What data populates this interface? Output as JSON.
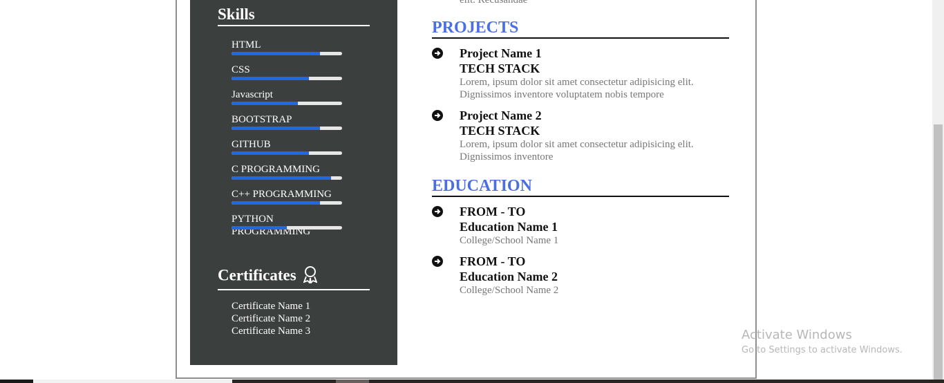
{
  "sidebar": {
    "skills_title": "Skills",
    "skills": [
      {
        "name": "HTML",
        "level": 0.8
      },
      {
        "name": "CSS",
        "level": 0.7
      },
      {
        "name": "Javascript",
        "level": 0.6
      },
      {
        "name": "BOOTSTRAP",
        "level": 0.8
      },
      {
        "name": "GITHUB",
        "level": 0.7
      },
      {
        "name": "C PROGRAMMING",
        "level": 0.9
      },
      {
        "name": "C++ PROGRAMMING",
        "level": 0.8
      },
      {
        "name": "PYTHON PROGRAMMING",
        "level": 0.5
      }
    ],
    "certificates_title": "Certificates",
    "certificates_icon": "award-ribbon-icon",
    "certificates": [
      "Certificate Name 1",
      "Certificate Name 2",
      "Certificate Name 3"
    ]
  },
  "main": {
    "top_cut_text": "elit. Recusandae",
    "projects_title": "PROJECTS",
    "projects": [
      {
        "name": "Project Name 1",
        "stack": "TECH STACK",
        "desc": "Lorem, ipsum dolor sit amet consectetur adipisicing elit. Dignissimos inventore voluptatem nobis tempore"
      },
      {
        "name": "Project Name 2",
        "stack": "TECH STACK",
        "desc": "Lorem, ipsum dolor sit amet consectetur adipisicing elit. Dignissimos inventore"
      }
    ],
    "education_title": "EDUCATION",
    "education": [
      {
        "period": "FROM - TO",
        "name": "Education Name 1",
        "school": "College/School Name 1"
      },
      {
        "period": "FROM - TO",
        "name": "Education Name 2",
        "school": "College/School Name 2"
      }
    ],
    "bullet_icon": "arrow-right-circle-icon"
  },
  "watermark": {
    "title": "Activate Windows",
    "subtitle": "Go to Settings to activate Windows."
  },
  "colors": {
    "sidebar_bg": "#3b3f3d",
    "heading_blue": "#4a6fe3",
    "bar_fill": "#1e6be0"
  }
}
